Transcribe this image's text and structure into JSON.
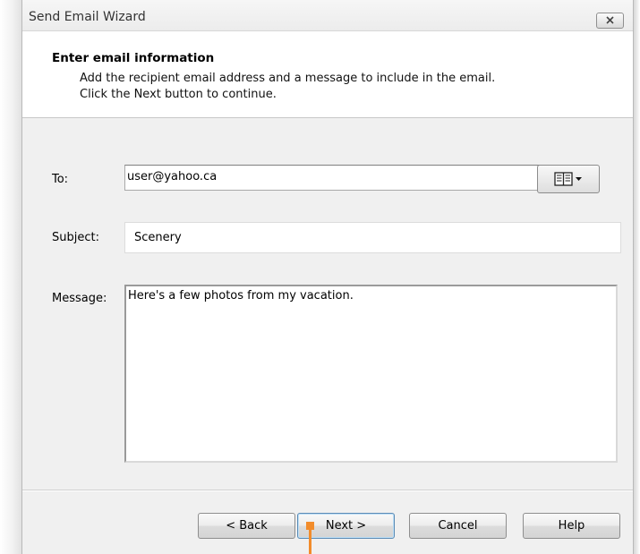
{
  "window": {
    "title": "Send Email Wizard"
  },
  "header": {
    "title": "Enter email information",
    "line1": "Add the recipient email address and a message to include in the email.",
    "line2": "Click the Next button to continue."
  },
  "form": {
    "to_label": "To:",
    "to_value": "user@yahoo.ca",
    "address_book_icon": "address-book-icon",
    "subject_label": "Subject:",
    "subject_value": "Scenery",
    "message_label": "Message:",
    "message_value": "Here's a few photos from my vacation."
  },
  "buttons": {
    "back": "< Back",
    "next": "Next >",
    "cancel": "Cancel",
    "help": "Help"
  },
  "colors": {
    "callout": "#f28c2b"
  }
}
